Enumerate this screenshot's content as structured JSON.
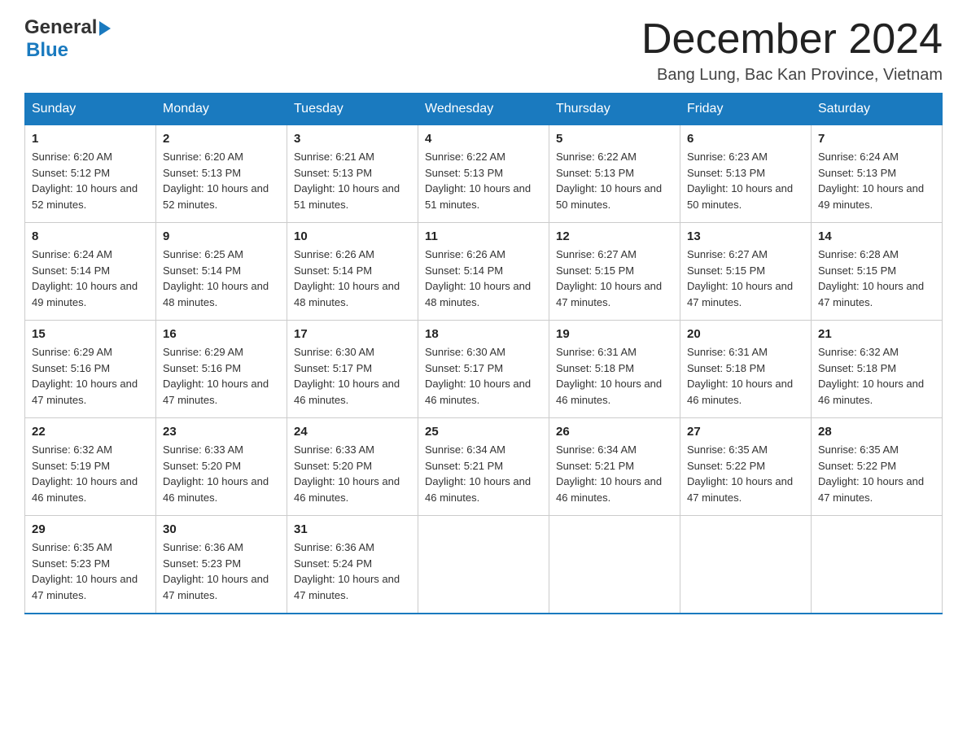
{
  "header": {
    "logo_general": "General",
    "logo_blue": "Blue",
    "month_title": "December 2024",
    "location": "Bang Lung, Bac Kan Province, Vietnam"
  },
  "days_of_week": [
    "Sunday",
    "Monday",
    "Tuesday",
    "Wednesday",
    "Thursday",
    "Friday",
    "Saturday"
  ],
  "weeks": [
    [
      {
        "day": "1",
        "sunrise": "6:20 AM",
        "sunset": "5:12 PM",
        "daylight": "10 hours and 52 minutes."
      },
      {
        "day": "2",
        "sunrise": "6:20 AM",
        "sunset": "5:13 PM",
        "daylight": "10 hours and 52 minutes."
      },
      {
        "day": "3",
        "sunrise": "6:21 AM",
        "sunset": "5:13 PM",
        "daylight": "10 hours and 51 minutes."
      },
      {
        "day": "4",
        "sunrise": "6:22 AM",
        "sunset": "5:13 PM",
        "daylight": "10 hours and 51 minutes."
      },
      {
        "day": "5",
        "sunrise": "6:22 AM",
        "sunset": "5:13 PM",
        "daylight": "10 hours and 50 minutes."
      },
      {
        "day": "6",
        "sunrise": "6:23 AM",
        "sunset": "5:13 PM",
        "daylight": "10 hours and 50 minutes."
      },
      {
        "day": "7",
        "sunrise": "6:24 AM",
        "sunset": "5:13 PM",
        "daylight": "10 hours and 49 minutes."
      }
    ],
    [
      {
        "day": "8",
        "sunrise": "6:24 AM",
        "sunset": "5:14 PM",
        "daylight": "10 hours and 49 minutes."
      },
      {
        "day": "9",
        "sunrise": "6:25 AM",
        "sunset": "5:14 PM",
        "daylight": "10 hours and 48 minutes."
      },
      {
        "day": "10",
        "sunrise": "6:26 AM",
        "sunset": "5:14 PM",
        "daylight": "10 hours and 48 minutes."
      },
      {
        "day": "11",
        "sunrise": "6:26 AM",
        "sunset": "5:14 PM",
        "daylight": "10 hours and 48 minutes."
      },
      {
        "day": "12",
        "sunrise": "6:27 AM",
        "sunset": "5:15 PM",
        "daylight": "10 hours and 47 minutes."
      },
      {
        "day": "13",
        "sunrise": "6:27 AM",
        "sunset": "5:15 PM",
        "daylight": "10 hours and 47 minutes."
      },
      {
        "day": "14",
        "sunrise": "6:28 AM",
        "sunset": "5:15 PM",
        "daylight": "10 hours and 47 minutes."
      }
    ],
    [
      {
        "day": "15",
        "sunrise": "6:29 AM",
        "sunset": "5:16 PM",
        "daylight": "10 hours and 47 minutes."
      },
      {
        "day": "16",
        "sunrise": "6:29 AM",
        "sunset": "5:16 PM",
        "daylight": "10 hours and 47 minutes."
      },
      {
        "day": "17",
        "sunrise": "6:30 AM",
        "sunset": "5:17 PM",
        "daylight": "10 hours and 46 minutes."
      },
      {
        "day": "18",
        "sunrise": "6:30 AM",
        "sunset": "5:17 PM",
        "daylight": "10 hours and 46 minutes."
      },
      {
        "day": "19",
        "sunrise": "6:31 AM",
        "sunset": "5:18 PM",
        "daylight": "10 hours and 46 minutes."
      },
      {
        "day": "20",
        "sunrise": "6:31 AM",
        "sunset": "5:18 PM",
        "daylight": "10 hours and 46 minutes."
      },
      {
        "day": "21",
        "sunrise": "6:32 AM",
        "sunset": "5:18 PM",
        "daylight": "10 hours and 46 minutes."
      }
    ],
    [
      {
        "day": "22",
        "sunrise": "6:32 AM",
        "sunset": "5:19 PM",
        "daylight": "10 hours and 46 minutes."
      },
      {
        "day": "23",
        "sunrise": "6:33 AM",
        "sunset": "5:20 PM",
        "daylight": "10 hours and 46 minutes."
      },
      {
        "day": "24",
        "sunrise": "6:33 AM",
        "sunset": "5:20 PM",
        "daylight": "10 hours and 46 minutes."
      },
      {
        "day": "25",
        "sunrise": "6:34 AM",
        "sunset": "5:21 PM",
        "daylight": "10 hours and 46 minutes."
      },
      {
        "day": "26",
        "sunrise": "6:34 AM",
        "sunset": "5:21 PM",
        "daylight": "10 hours and 46 minutes."
      },
      {
        "day": "27",
        "sunrise": "6:35 AM",
        "sunset": "5:22 PM",
        "daylight": "10 hours and 47 minutes."
      },
      {
        "day": "28",
        "sunrise": "6:35 AM",
        "sunset": "5:22 PM",
        "daylight": "10 hours and 47 minutes."
      }
    ],
    [
      {
        "day": "29",
        "sunrise": "6:35 AM",
        "sunset": "5:23 PM",
        "daylight": "10 hours and 47 minutes."
      },
      {
        "day": "30",
        "sunrise": "6:36 AM",
        "sunset": "5:23 PM",
        "daylight": "10 hours and 47 minutes."
      },
      {
        "day": "31",
        "sunrise": "6:36 AM",
        "sunset": "5:24 PM",
        "daylight": "10 hours and 47 minutes."
      },
      null,
      null,
      null,
      null
    ]
  ]
}
